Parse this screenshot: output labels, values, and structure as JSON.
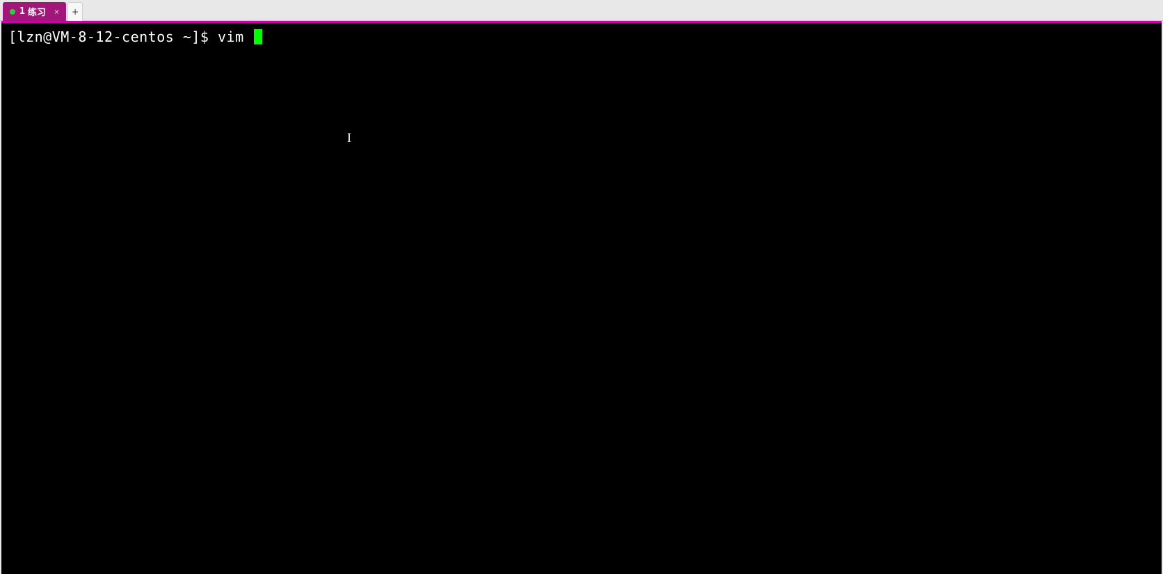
{
  "tabs": {
    "active": {
      "number": "1",
      "title": "练习",
      "close": "×"
    },
    "add_label": "+"
  },
  "terminal": {
    "prompt": "[lzn@VM-8-12-centos ~]$ ",
    "command": "vim "
  },
  "cursor_text": "I"
}
